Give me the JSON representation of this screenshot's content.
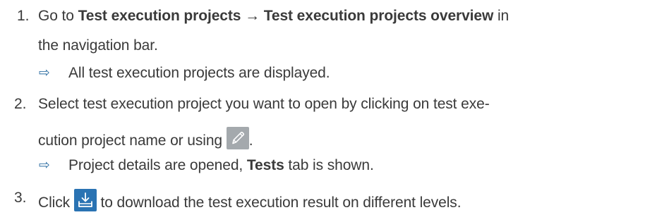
{
  "steps": [
    {
      "number": "1.",
      "line1": {
        "pre": "Go to ",
        "b1": "Test execution projects",
        "arrow": " → ",
        "b2": "Test execution projects overview",
        "post": " in"
      },
      "line2": "the navigation bar.",
      "result": {
        "text": "All test execution projects are displayed."
      }
    },
    {
      "number": "2.",
      "line1": "Select test execution project you want to open by clicking on test exe-",
      "line2": "cution project name or using ",
      "line2_end": ".",
      "icon": "edit-pencil-icon",
      "result": {
        "pre": "Project details are opened, ",
        "bold": "Tests",
        "post": " tab is shown."
      }
    },
    {
      "number": "3.",
      "pre": "Click ",
      "icon": "download-icon",
      "post": " to download the test execution result on different levels."
    }
  ],
  "result_arrow_glyph": "⇨",
  "colors": {
    "text": "#3a3a3a",
    "result_arrow": "#2f6fa3",
    "edit_icon_bg": "#a4a9ad",
    "download_icon_bg": "#2a73b3"
  }
}
